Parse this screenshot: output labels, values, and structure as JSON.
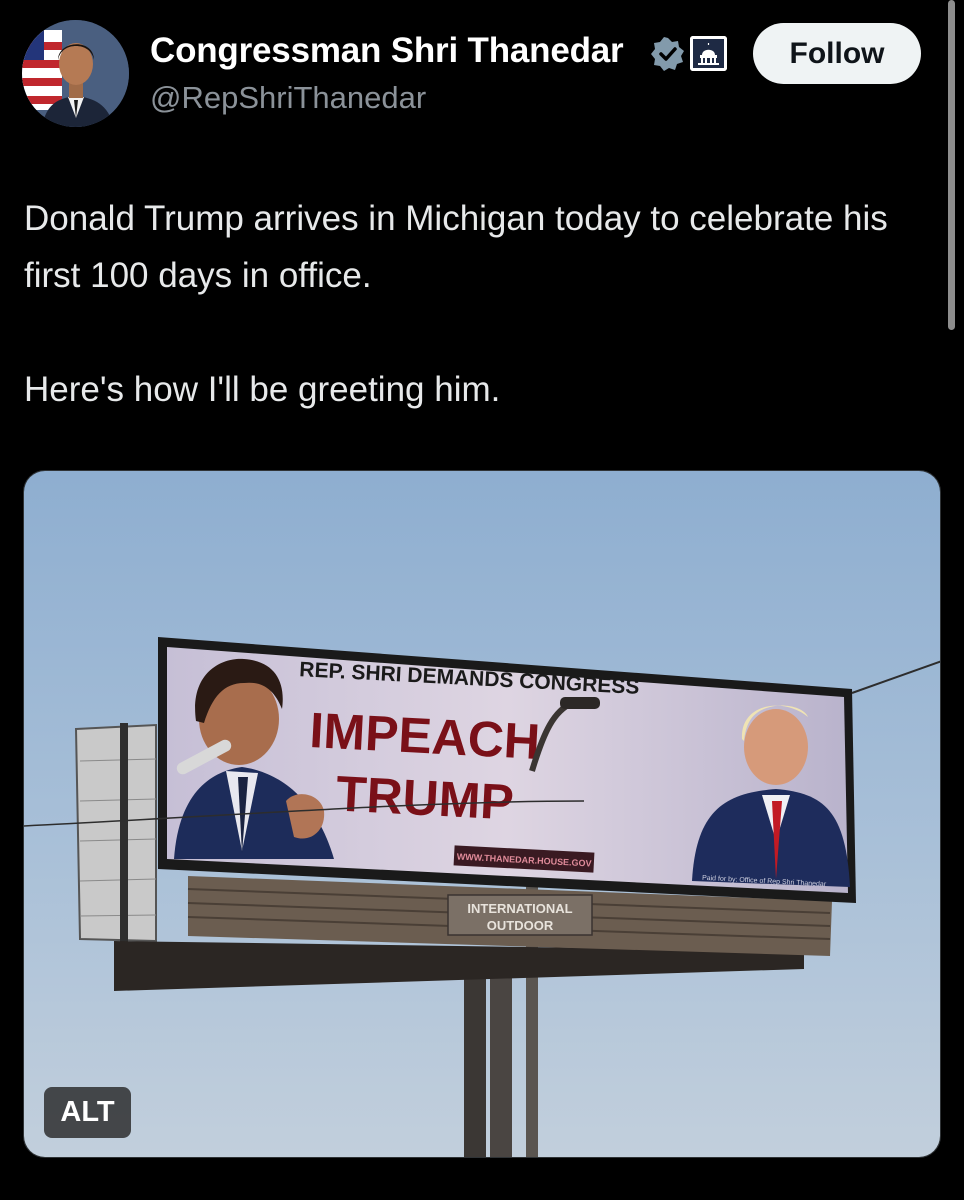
{
  "author": {
    "display_name": "Congressman Shri Thanedar",
    "handle": "@RepShriThanedar",
    "avatar_icon": "profile-photo",
    "verified_icon": "verified-badge-icon",
    "affiliation_icon": "capitol-dome-icon",
    "follow_label": "Follow"
  },
  "tweet": {
    "paragraphs": [
      "Donald Trump arrives in Michigan today to celebrate his first 100 days in office.",
      "Here's how I'll be greeting him."
    ]
  },
  "media": {
    "alt_label": "ALT",
    "billboard": {
      "header": "REP. SHRI DEMANDS CONGRESS",
      "headline_1": "IMPEACH",
      "headline_2": "TRUMP",
      "url": "WWW.THANEDAR.HOUSE.GOV",
      "disclaimer": "Paid for by: Office of Rep Shri Thanedar",
      "owner_1": "INTERNATIONAL",
      "owner_2": "OUTDOOR"
    }
  },
  "colors": {
    "background": "#000000",
    "text": "#e7e9ea",
    "muted": "#8b9299",
    "verified": "#829aab",
    "headline_red": "#7a1018"
  }
}
